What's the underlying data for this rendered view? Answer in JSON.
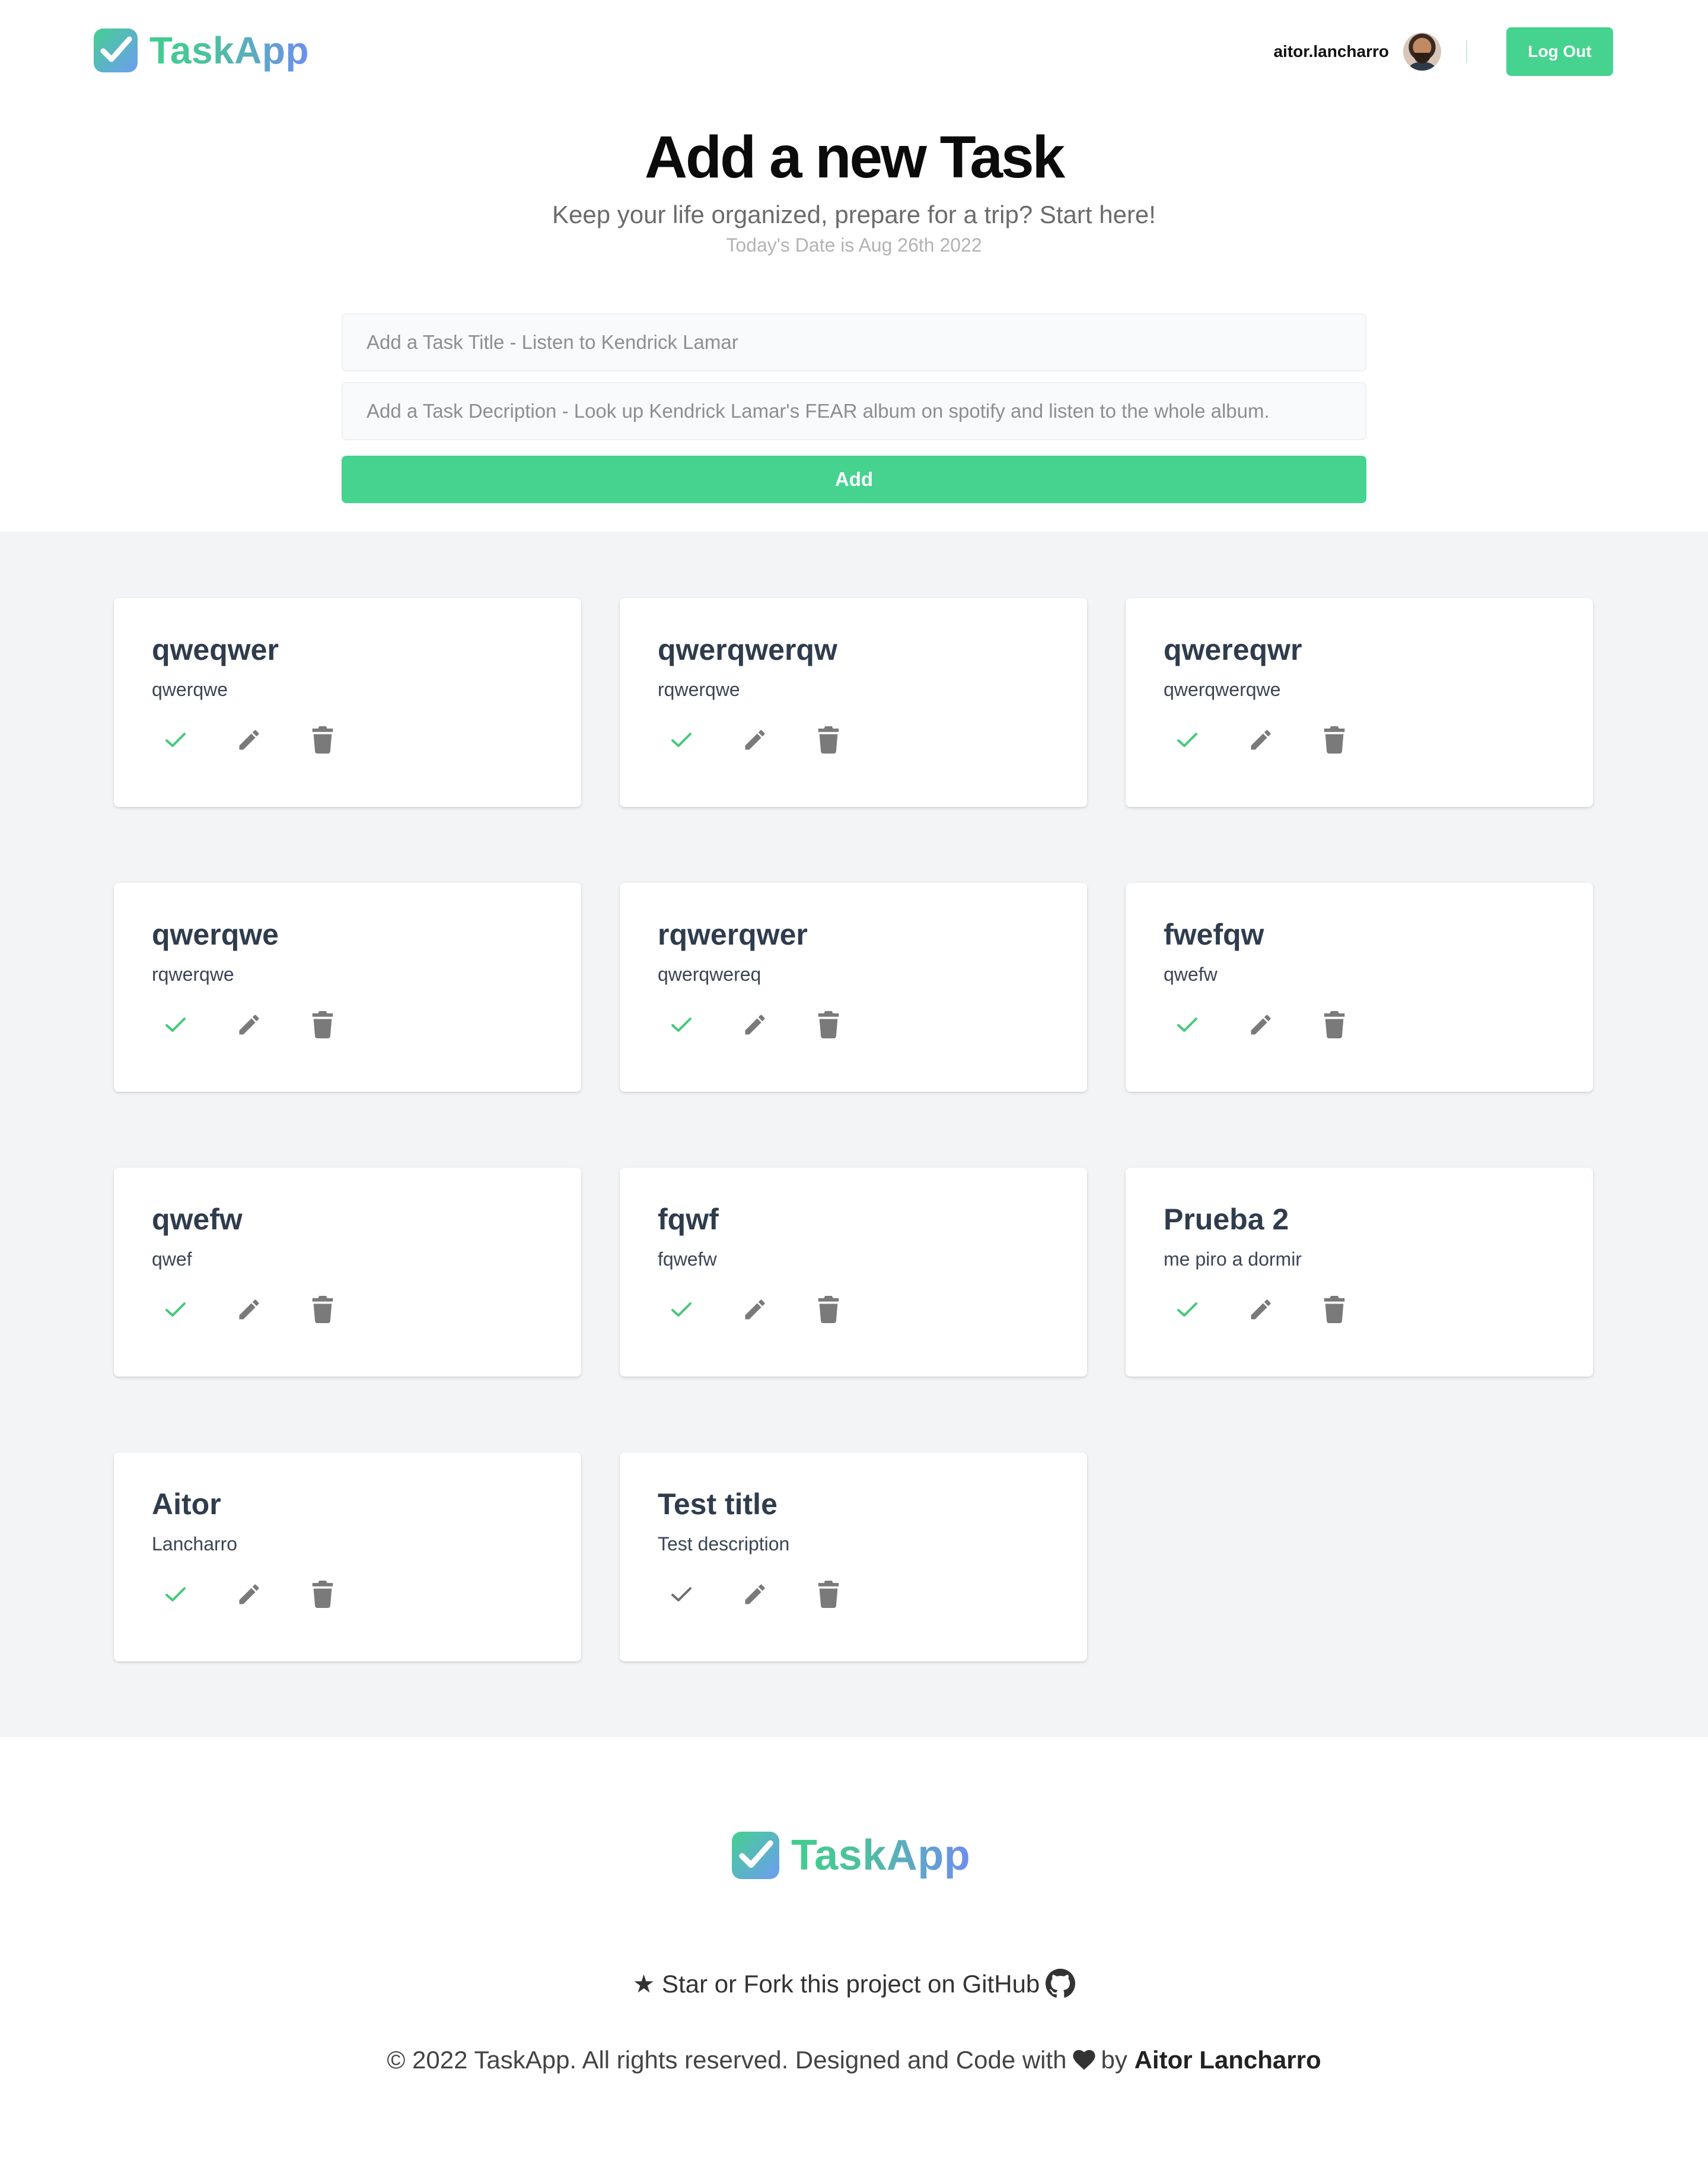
{
  "brand": {
    "name": "TaskApp",
    "primary_color": "#45d38f",
    "secondary_color": "#6d9cf3"
  },
  "header": {
    "username": "aitor.lancharro",
    "logout_label": "Log Out"
  },
  "hero": {
    "title": "Add a new Task",
    "subtitle": "Keep your life organized, prepare for a trip? Start here!",
    "date_text": "Today's Date is Aug 26th 2022"
  },
  "form": {
    "title_placeholder": "Add a Task Title - Listen to Kendrick Lamar",
    "description_placeholder": "Add a Task Decription - Look up Kendrick Lamar's FEAR album on spotify and listen to the whole album.",
    "add_label": "Add"
  },
  "tasks": [
    {
      "title": "qweqwer",
      "description": "qwerqwe",
      "completed": true
    },
    {
      "title": "qwerqwerqw",
      "description": "rqwerqwe",
      "completed": true
    },
    {
      "title": "qwereqwr",
      "description": "qwerqwerqwe",
      "completed": true
    },
    {
      "title": "qwerqwe",
      "description": "rqwerqwe",
      "completed": true
    },
    {
      "title": "rqwerqwer",
      "description": "qwerqwereq",
      "completed": true
    },
    {
      "title": "fwefqw",
      "description": "qwefw",
      "completed": true
    },
    {
      "title": "qwefw",
      "description": "qwef",
      "completed": true
    },
    {
      "title": "fqwf",
      "description": "fqwefw",
      "completed": true
    },
    {
      "title": "Prueba 2",
      "description": "me piro a dormir",
      "completed": true
    },
    {
      "title": "Aitor",
      "description": "Lancharro",
      "completed": true
    },
    {
      "title": "Test title",
      "description": "Test description",
      "completed": false
    }
  ],
  "footer": {
    "brand": "TaskApp",
    "github_text": "★ Star or Fork this project on GitHub",
    "copyright_text": "© 2022 TaskApp. All rights reserved. Designed and Code with",
    "by_text": "by",
    "author": "Aitor Lancharro"
  },
  "icons": {
    "check": "check-icon",
    "edit": "pencil-icon",
    "delete": "trash-icon",
    "github": "github-icon",
    "heart": "heart-icon"
  }
}
